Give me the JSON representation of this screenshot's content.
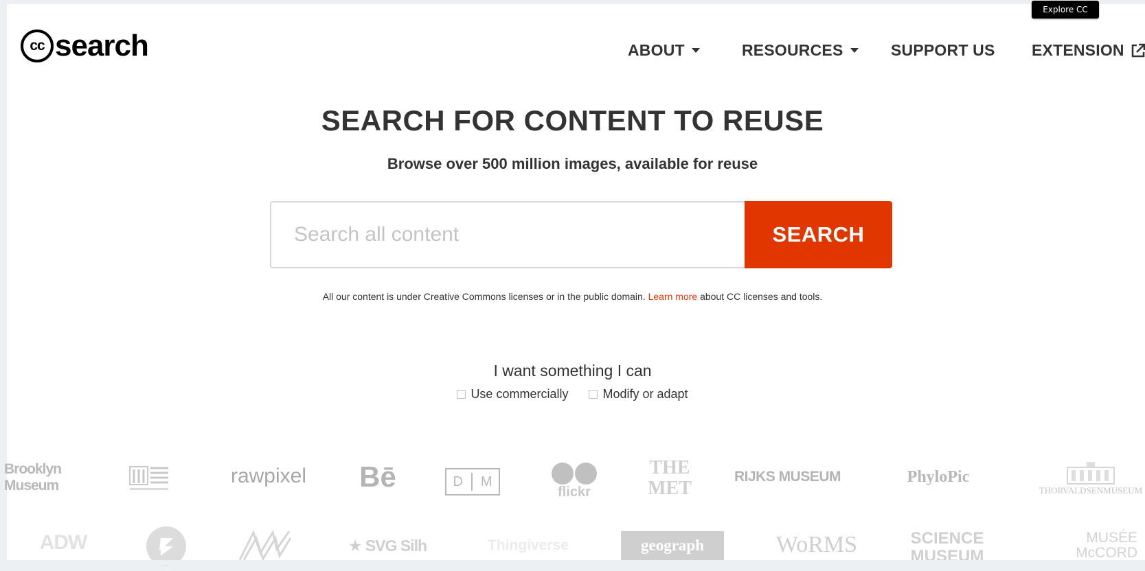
{
  "explore_cc": "Explore CC",
  "logo": {
    "cc": "cc",
    "word": "search"
  },
  "nav": {
    "about": "ABOUT",
    "resources": "RESOURCES",
    "support_us": "SUPPORT US",
    "extension": "EXTENSION"
  },
  "hero": {
    "title": "SEARCH FOR CONTENT TO REUSE",
    "subtitle": "Browse over 500 million images, available for reuse"
  },
  "search": {
    "placeholder": "Search all content",
    "button": "SEARCH"
  },
  "license_note": {
    "prefix": "All our content is under Creative Commons licenses or in the public domain.",
    "link": "Learn more",
    "suffix": "about CC licenses and tools."
  },
  "filters": {
    "title": "I want something I can",
    "options": [
      "Use commercially",
      "Modify or adapt"
    ]
  },
  "providers_row1": [
    "Brooklyn Museum",
    "The Cleveland Museum of Art",
    "rawpixel",
    "Bē",
    "D M",
    "flickr",
    "THE MET",
    "RIJKS MUSEUM",
    "PhyloPic",
    "THORVALDSEN MUSEUM"
  ],
  "providers_row2": [
    "ADW",
    "Deviant",
    "NYPL",
    "SVG Silh",
    "Thingiverse",
    "geograph",
    "WoRMS",
    "SCIENCE MUSEUM",
    "MUSÉE McCORD"
  ],
  "provider_text": {
    "brooklyn_1": "Brooklyn",
    "brooklyn_2": "Museum",
    "rawpixel": "rawpixel",
    "be": "Bē",
    "dm_d": "D",
    "dm_m": "M",
    "flickr": "flickr",
    "met_1": "THE",
    "met_2": "MET",
    "rijks": "RIJKS MUSEUM",
    "phylopic": "PhyloPic",
    "thorvaldsen": "THORVALDSENMUSEUM",
    "adw": "ADW",
    "svg": "★ SVG Silh",
    "thingiverse": "Thingiverse",
    "geograph": "geograph",
    "worms": "WoRMS",
    "science_1": "SCIENCE",
    "science_2": "MUSEUM",
    "mccord_1": "MUSÉE",
    "mccord_2": "McCORD"
  },
  "colors": {
    "accent": "#e23600",
    "text": "#333333",
    "logo_grey": "#b8b8b8"
  }
}
